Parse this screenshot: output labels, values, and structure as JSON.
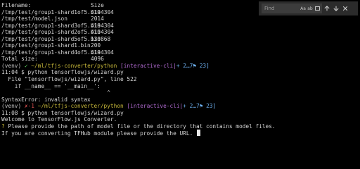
{
  "output": {
    "header": {
      "filename": "Filename:",
      "size": "Size"
    },
    "files": [
      {
        "name": "/tmp/test/group1-shard1of5.bin",
        "size": "4194304"
      },
      {
        "name": "/tmp/test/model.json",
        "size": "2014"
      },
      {
        "name": "/tmp/test/group1-shard3of5.bin",
        "size": "4194304"
      },
      {
        "name": "/tmp/test/group1-shard2of5.bin",
        "size": "4194304"
      },
      {
        "name": "/tmp/test/group1-shard5of5.bin",
        "size": "130868"
      },
      {
        "name": "/tmp/test/group1-shard1.bin",
        "size": "200"
      },
      {
        "name": "/tmp/test/group1-shard4of5.bin",
        "size": "4194304"
      }
    ],
    "total_label": "Total size:",
    "total_value": "4096"
  },
  "prompt1": {
    "venv": "(venv)",
    "status": "✓",
    "path": "~/ml/tfjs-converter/python",
    "branch": "[interactive-cli|",
    "stat": "+ 2…7⚑ 23]"
  },
  "session1": {
    "time_cmd": "11:04 $ python tensorflowjs/wizard.py",
    "trace_file": "  File \"tensorflowjs/wizard.py\", line 522",
    "code": "    if __name__ == '__main__':",
    "caret": "                                ^",
    "error": "SyntaxError: invalid syntax"
  },
  "prompt2": {
    "venv": "(venv)",
    "status": "✗-1",
    "path": "~/ml/tfjs-converter/python",
    "branch": "[interactive-cli|",
    "stat": "+ 2…7⚑ 23]"
  },
  "session2": {
    "time_cmd": "11:08 $ python tensorflowjs/wizard.py",
    "welcome": "Welcome to TensorFlow.js Converter.",
    "question_mark": "?",
    "question": " Please provide the path of model file or the directory that contains model files.",
    "hint": "If you are converting TFHub module please provide the URL."
  },
  "find": {
    "placeholder": "Find",
    "match_case": "Aa",
    "whole_word": "ab",
    "icons": [
      "arrow-up-icon",
      "arrow-down-icon",
      "close-icon"
    ]
  }
}
